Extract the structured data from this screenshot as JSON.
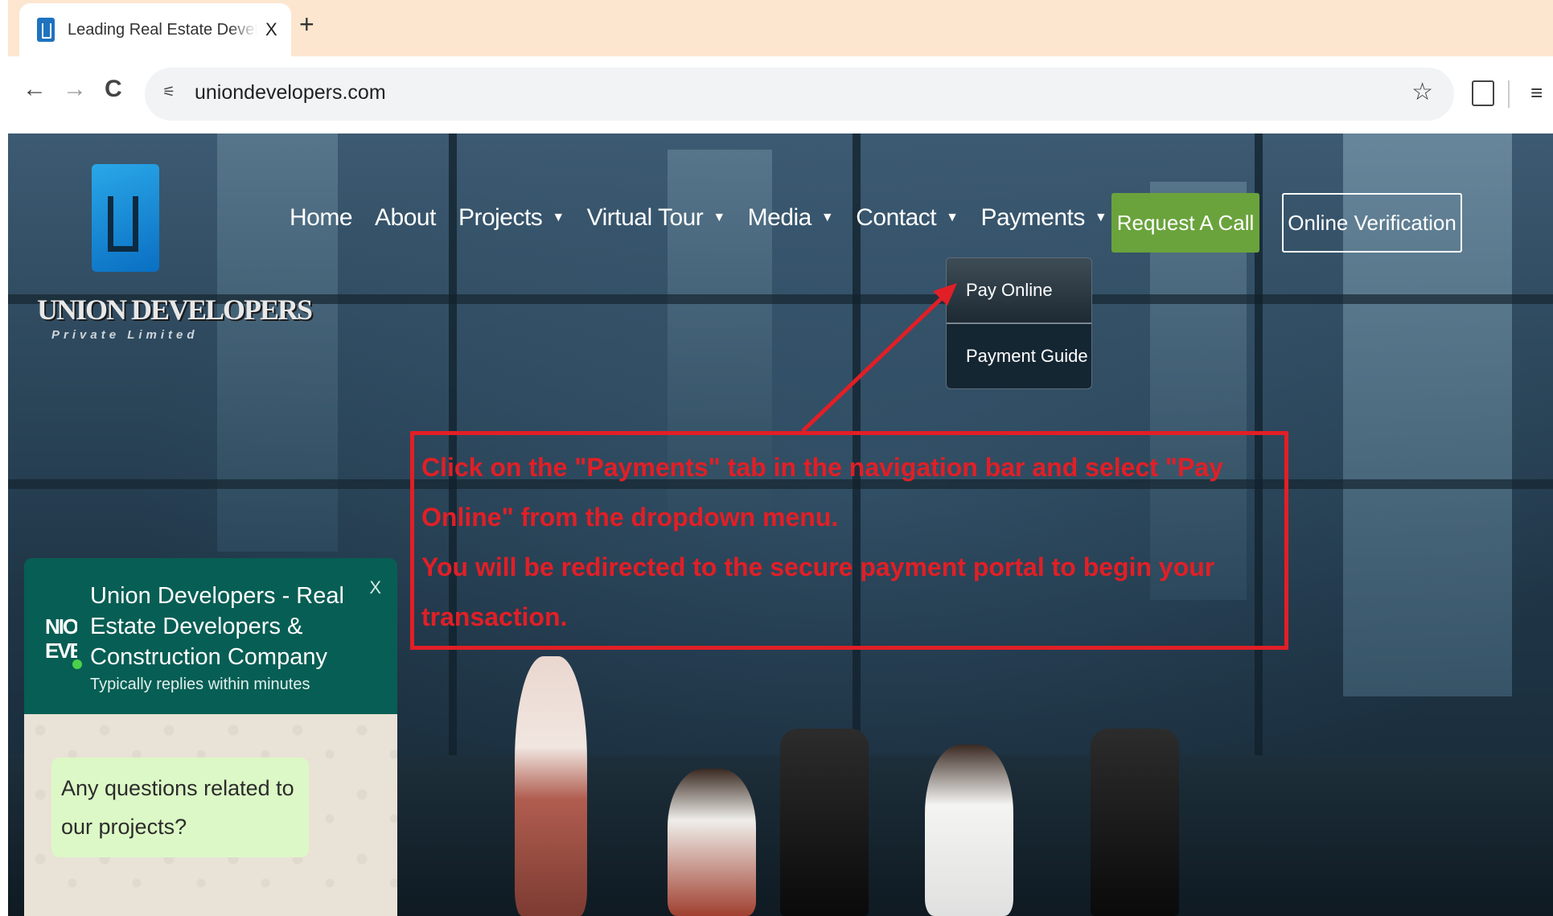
{
  "browser": {
    "tab_title": "Leading Real Estate Developers",
    "tab_close": "X",
    "new_tab": "+",
    "url": "uniondevelopers.com"
  },
  "icons": {
    "back": "←",
    "forward": "→",
    "reload": "C",
    "site_info": "⚟",
    "star": "☆",
    "list": "≡"
  },
  "site": {
    "logo_text": "UNION DEVELOPERS",
    "logo_subtext": "Private Limited",
    "nav": [
      {
        "label": "Home",
        "dropdown": false
      },
      {
        "label": "About",
        "dropdown": false
      },
      {
        "label": "Projects",
        "dropdown": true
      },
      {
        "label": "Virtual Tour",
        "dropdown": true
      },
      {
        "label": "Media",
        "dropdown": true
      },
      {
        "label": "Contact",
        "dropdown": true
      },
      {
        "label": "Payments",
        "dropdown": true
      }
    ],
    "caret": "▼",
    "request_call": "Request A Call",
    "online_verification": "Online Verification",
    "payments_menu": [
      "Pay Online",
      "Payment Guide"
    ]
  },
  "annotation": {
    "line1": "Click on the \"Payments\" tab in the navigation bar and select \"Pay Online\" from the dropdown menu.",
    "line2": "You will be redirected to the secure payment portal to begin your transaction.",
    "color": "#e11f26"
  },
  "whatsapp": {
    "avatar_text": "NIOI\nEVE",
    "title": "Union Developers - Real Estate Developers & Construction Company",
    "subtitle": "Typically replies within minutes",
    "close": "X",
    "message": "Any questions related to our projects?"
  },
  "colors": {
    "tabbar": "#fde6cf",
    "request_button": "#6aa33c",
    "whatsapp_header": "#075e54",
    "whatsapp_bubble": "#dcf8c6"
  }
}
